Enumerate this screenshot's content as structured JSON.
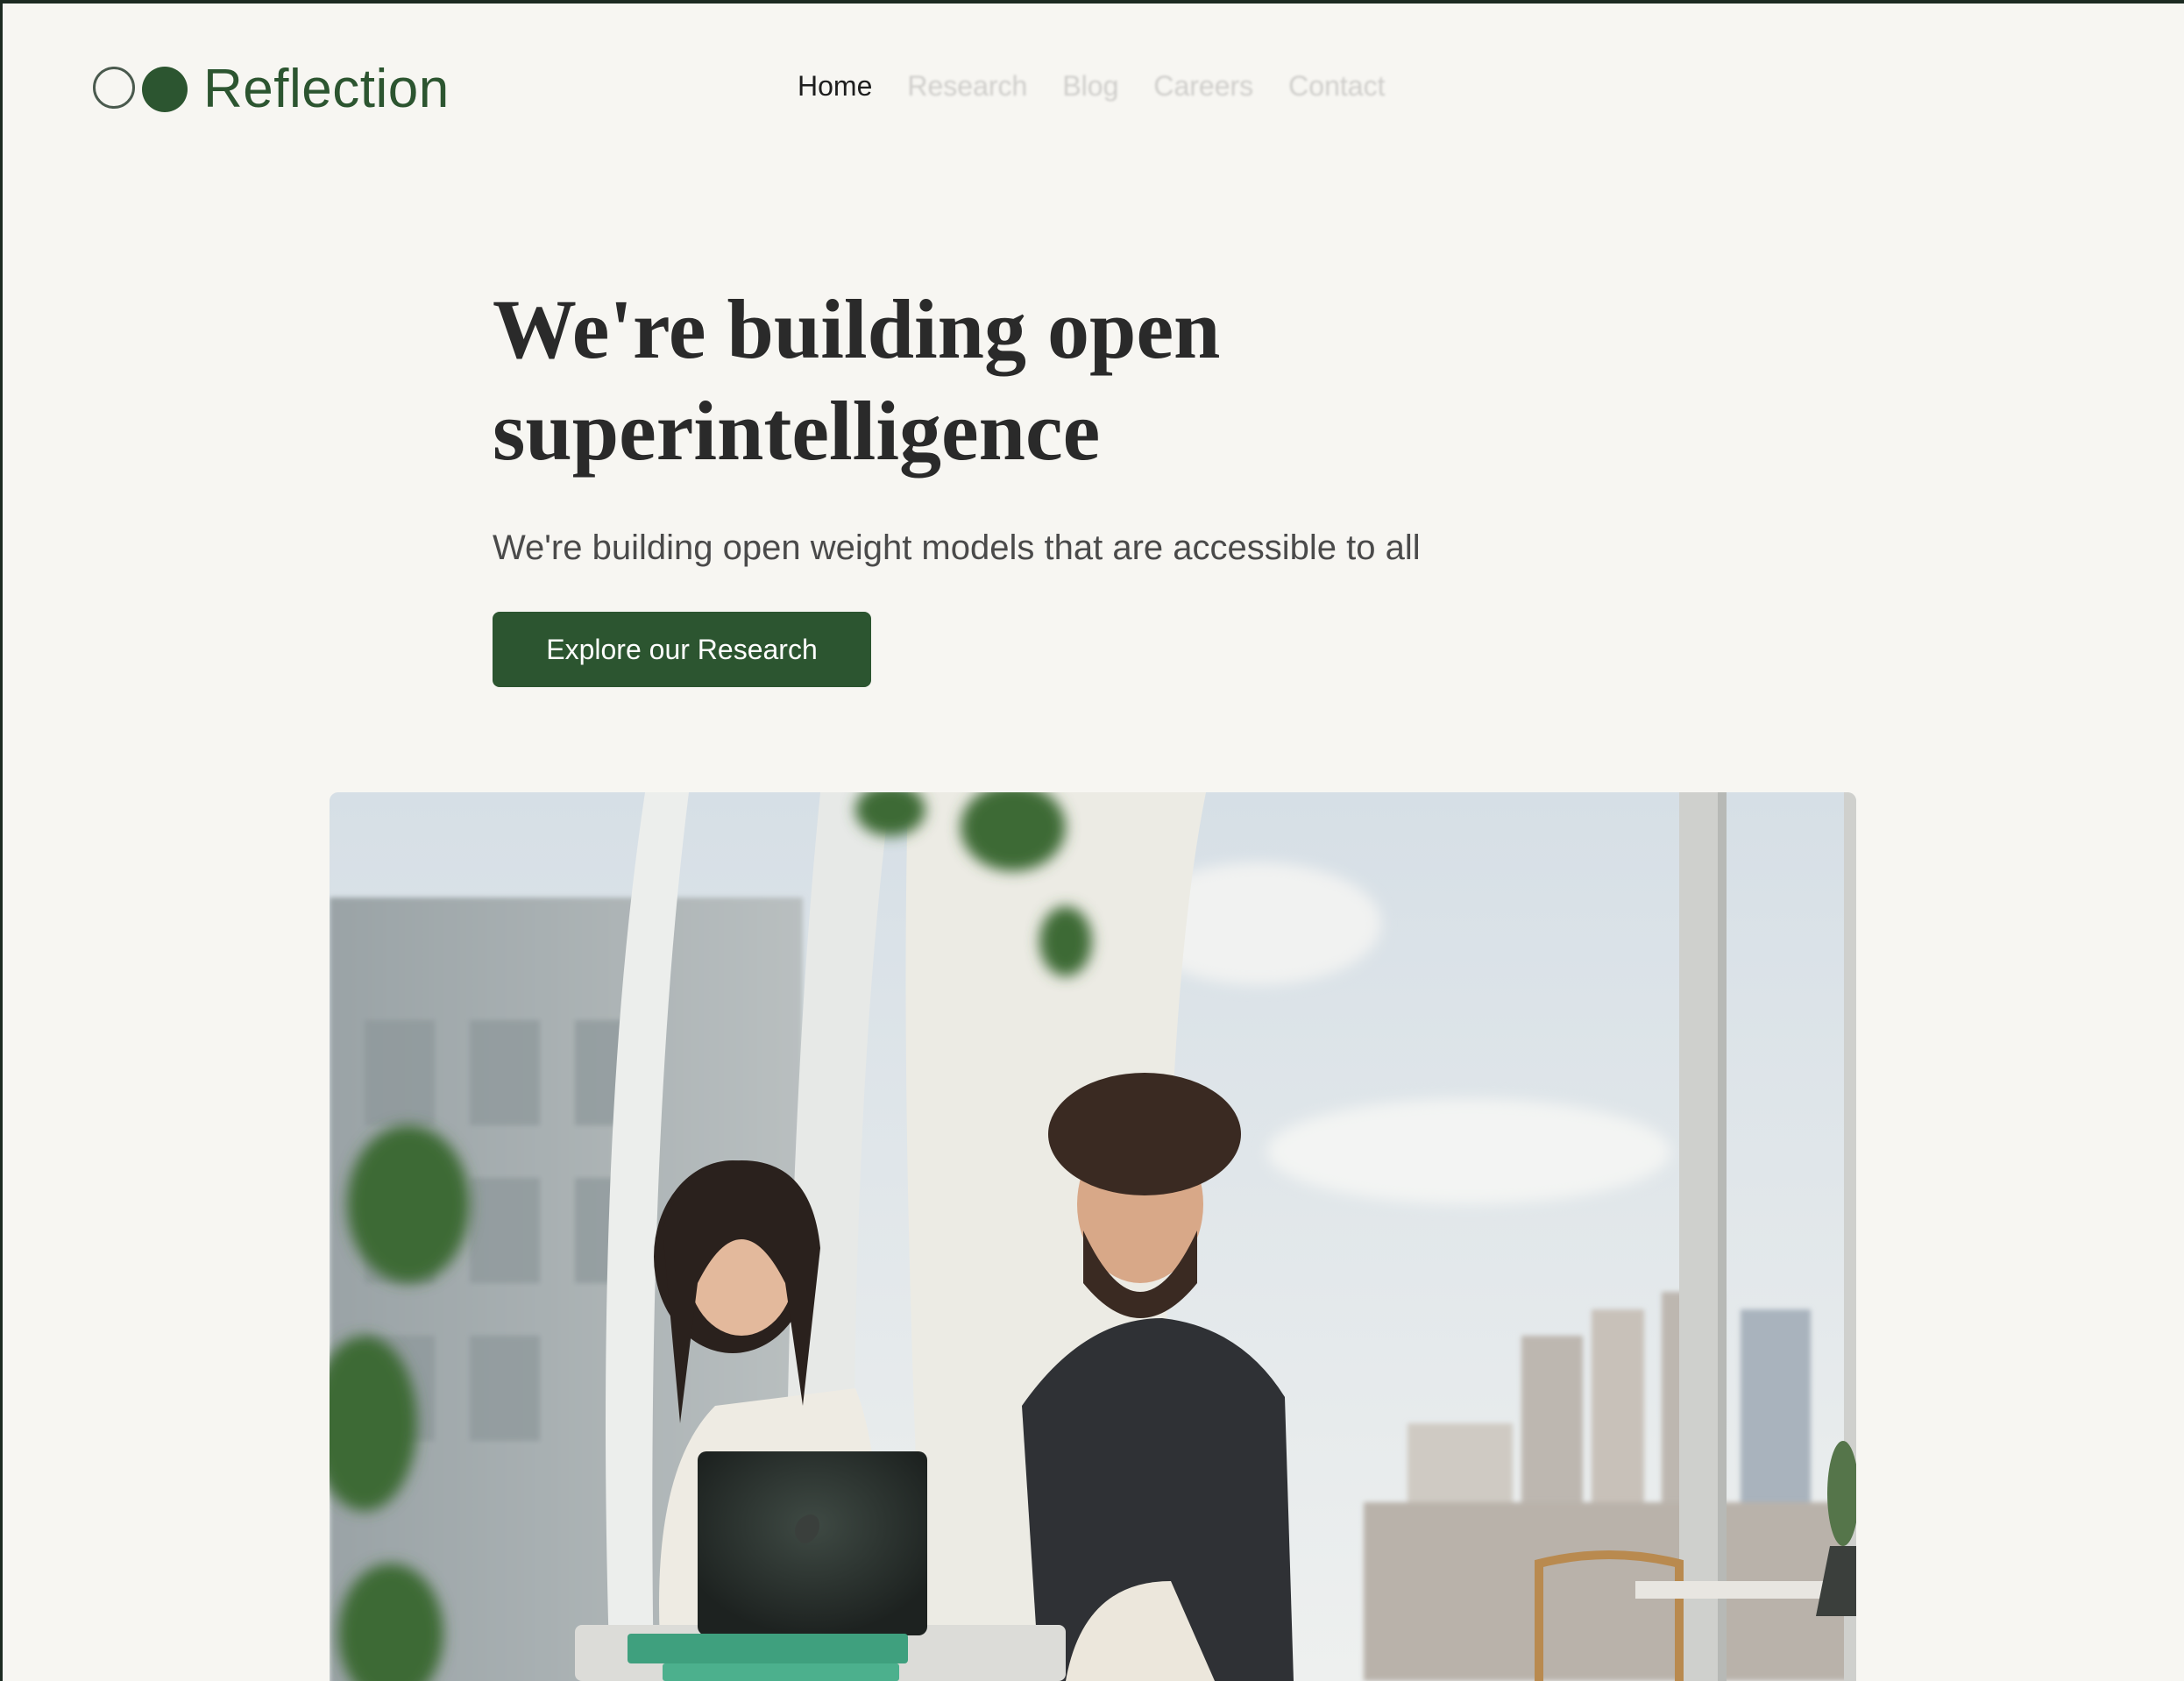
{
  "brand": {
    "name": "Reflection",
    "logo_icon": "two-circles-logo",
    "accent_color": "#2c5530"
  },
  "nav": {
    "items": [
      {
        "label": "Home",
        "active": true
      },
      {
        "label": "Research",
        "active": false
      },
      {
        "label": "Blog",
        "active": false
      },
      {
        "label": "Careers",
        "active": false
      },
      {
        "label": "Contact",
        "active": false
      }
    ]
  },
  "hero": {
    "title_line1": "We're building open",
    "title_line2": "superintelligence",
    "subtitle": "We're building open weight models that are accessible to all",
    "cta_label": "Explore our Research"
  },
  "hero_image": {
    "description": "photo"
  }
}
